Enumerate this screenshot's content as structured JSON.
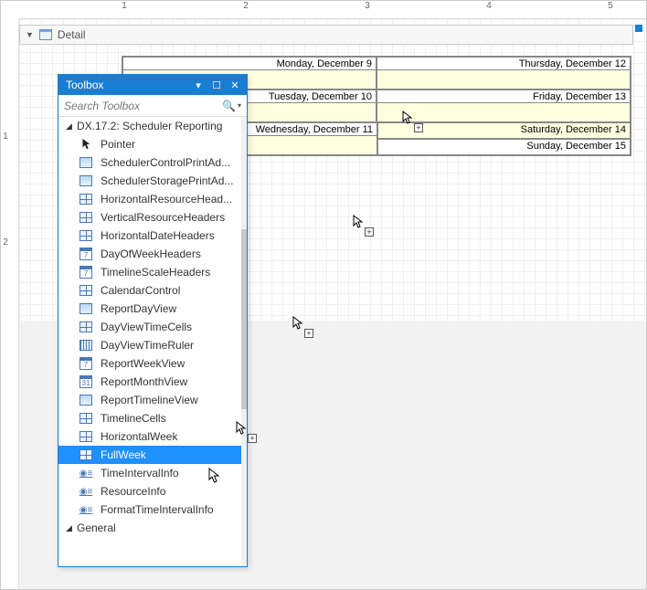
{
  "ruler": {
    "labels": [
      "1",
      "2",
      "3",
      "4",
      "5"
    ],
    "v_labels": [
      "1",
      "2"
    ]
  },
  "detail": {
    "label": "Detail"
  },
  "scheduler": {
    "rows": [
      {
        "left": "Monday, December 9",
        "right": "Thursday, December 12"
      },
      {
        "left": "Tuesday, December 10",
        "right": "Friday, December 13"
      },
      {
        "left": "Wednesday, December 11",
        "right_top": "Saturday, December 14",
        "right_bottom": "Sunday, December 15"
      }
    ]
  },
  "toolbox": {
    "title": "Toolbox",
    "search_placeholder": "Search Toolbox",
    "category1": "DX.17.2: Scheduler Reporting",
    "category2": "General",
    "items": [
      {
        "label": "Pointer",
        "icon": "pointer"
      },
      {
        "label": "SchedulerControlPrintAd...",
        "icon": "box"
      },
      {
        "label": "SchedulerStoragePrintAd...",
        "icon": "box"
      },
      {
        "label": "HorizontalResourceHead...",
        "icon": "grid"
      },
      {
        "label": "VerticalResourceHeaders",
        "icon": "grid"
      },
      {
        "label": "HorizontalDateHeaders",
        "icon": "grid"
      },
      {
        "label": "DayOfWeekHeaders",
        "icon": "calnum",
        "num": "7"
      },
      {
        "label": "TimelineScaleHeaders",
        "icon": "calnum",
        "num": "7"
      },
      {
        "label": "CalendarControl",
        "icon": "grid"
      },
      {
        "label": "ReportDayView",
        "icon": "box"
      },
      {
        "label": "DayViewTimeCells",
        "icon": "grid"
      },
      {
        "label": "DayViewTimeRuler",
        "icon": "ruler"
      },
      {
        "label": "ReportWeekView",
        "icon": "calnum",
        "num": "7"
      },
      {
        "label": "ReportMonthView",
        "icon": "calnum",
        "num": "31"
      },
      {
        "label": "ReportTimelineView",
        "icon": "box"
      },
      {
        "label": "TimelineCells",
        "icon": "grid"
      },
      {
        "label": "HorizontalWeek",
        "icon": "grid"
      },
      {
        "label": "FullWeek",
        "icon": "grid",
        "selected": true
      },
      {
        "label": "TimeIntervalInfo",
        "icon": "info"
      },
      {
        "label": "ResourceInfo",
        "icon": "info"
      },
      {
        "label": "FormatTimeIntervalInfo",
        "icon": "info"
      }
    ]
  }
}
